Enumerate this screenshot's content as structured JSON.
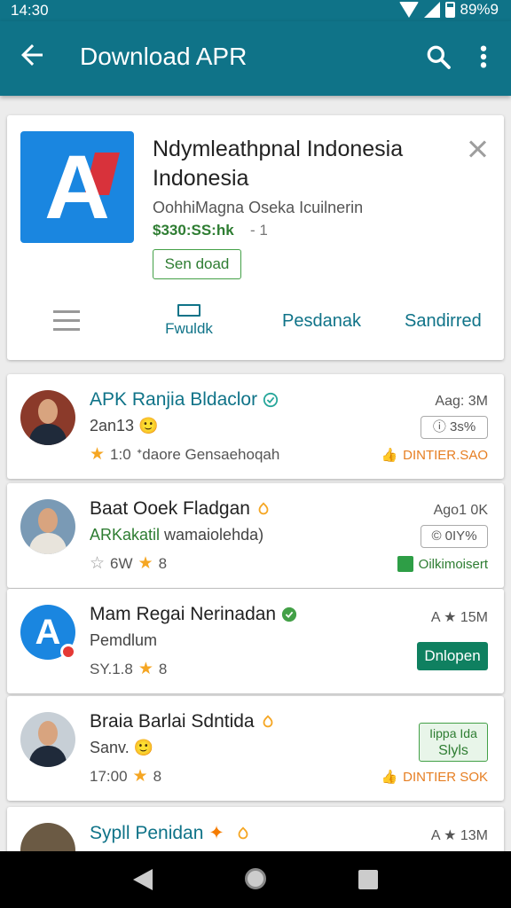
{
  "status": {
    "time": "14:30",
    "battery": "89%9"
  },
  "app_bar": {
    "title": "Download APR"
  },
  "detail": {
    "name": "Ndymleathpnal Indonesia Indonesia",
    "developer": "OohhiMagna Oseka Icuilnerin",
    "price": "$330:SS:hk",
    "price_suffix": "- 1",
    "send_label": "Sen doad",
    "tabs": {
      "doc_label": "Fwuldk",
      "tab2": "Pesdanak",
      "tab3": "Sandirred"
    }
  },
  "items": [
    {
      "title": "APK Ranjia Bldaclor",
      "title_color": "#0f7388",
      "sub": "2an13",
      "rating": "1:0",
      "meta_text": "ᐩdaore Gensaehoqah",
      "size": "Aag: 3M",
      "badge": "ⓘ 3s%",
      "action": "DINTIER.SAO"
    },
    {
      "title": "Baat Ooek Fladgan",
      "title_color": "#222",
      "sub": "ARKakatil wamaiolehda)",
      "sub_prefix": "ARKakatil",
      "sub_rest": " wamaiolehda)",
      "rating_left": "6W",
      "rating": "8",
      "size": "Ago1 0K",
      "badge": "© 0IY%",
      "action": "Oilkimoisert"
    },
    {
      "title": "Mam Regai Nerinadan",
      "title_color": "#222",
      "sub": "Pemdlum",
      "rating_left": "SY.1.8",
      "rating": "8",
      "size": "A ★ 15M",
      "button": "Dnlopen"
    },
    {
      "title": "Braia  Barlai Sdntida",
      "title_color": "#222",
      "sub": "Sanv.",
      "rating_left": "17:00",
      "rating": "8",
      "button_line1": "Iippa Ida",
      "button_line2": "Slyls",
      "action": "DINTIER SOK"
    },
    {
      "title": "Sypll Penidan",
      "title_color": "#0f7388",
      "size": "A ★ 13M"
    }
  ]
}
